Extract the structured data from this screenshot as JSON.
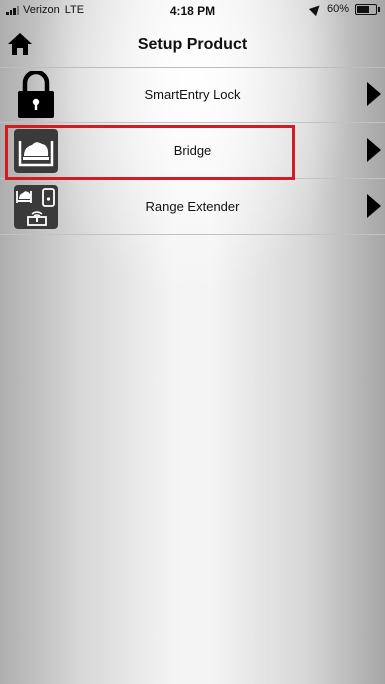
{
  "status_bar": {
    "carrier": "Verizon",
    "network": "LTE",
    "time": "4:18 PM",
    "battery": "60%",
    "icons": [
      "signal-icon",
      "location-icon",
      "battery-icon"
    ]
  },
  "nav": {
    "title": "Setup Product",
    "home_icon": "home-icon"
  },
  "products": [
    {
      "label": "SmartEntry Lock",
      "icon": "padlock-icon",
      "arrow": "chevron-right-icon"
    },
    {
      "label": "Bridge",
      "icon": "bridge-icon",
      "arrow": "chevron-right-icon",
      "highlighted": true
    },
    {
      "label": "Range Extender",
      "icon": "range-extender-icon",
      "arrow": "chevron-right-icon"
    }
  ],
  "colors": {
    "highlight_border": "#d01d24",
    "icon_tile": "#3a3a3a"
  }
}
